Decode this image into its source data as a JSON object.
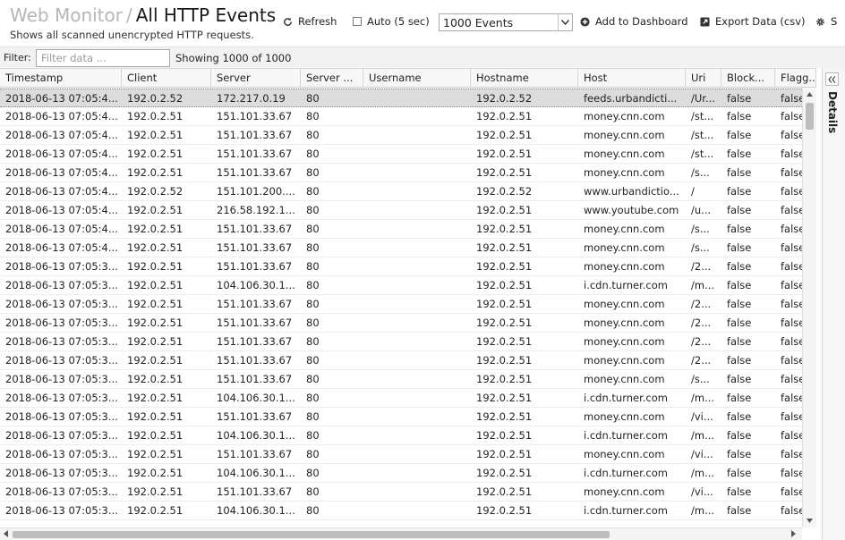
{
  "header": {
    "crumb": "Web Monitor",
    "separator": "/",
    "page_title": "All HTTP Events",
    "subtitle": "Shows all scanned unencrypted HTTP requests."
  },
  "toolbar": {
    "refresh_label": "Refresh",
    "auto_label": "Auto (5 sec)",
    "auto_checked": false,
    "events_select_value": "1000 Events",
    "add_dashboard_label": "Add to Dashboard",
    "export_label": "Export Data (csv)",
    "settings_label": "S"
  },
  "filter": {
    "label": "Filter:",
    "placeholder": "Filter data ...",
    "showing": "Showing 1000 of 1000"
  },
  "details_label": "Details",
  "columns": [
    "Timestamp",
    "Client",
    "Server",
    "Server ...",
    "Username",
    "Hostname",
    "Host",
    "Uri",
    "Block...",
    "Flagg..."
  ],
  "rows": [
    [
      "2018-06-13 07:05:4...",
      "192.0.2.52",
      "172.217.0.19",
      "80",
      "",
      "192.0.2.52",
      "feeds.urbandicti...",
      "/Ur...",
      "false",
      "false"
    ],
    [
      "2018-06-13 07:05:4...",
      "192.0.2.51",
      "151.101.33.67",
      "80",
      "",
      "192.0.2.51",
      "money.cnn.com",
      "/st...",
      "false",
      "false"
    ],
    [
      "2018-06-13 07:05:4...",
      "192.0.2.51",
      "151.101.33.67",
      "80",
      "",
      "192.0.2.51",
      "money.cnn.com",
      "/st...",
      "false",
      "false"
    ],
    [
      "2018-06-13 07:05:4...",
      "192.0.2.51",
      "151.101.33.67",
      "80",
      "",
      "192.0.2.51",
      "money.cnn.com",
      "/st...",
      "false",
      "false"
    ],
    [
      "2018-06-13 07:05:4...",
      "192.0.2.51",
      "151.101.33.67",
      "80",
      "",
      "192.0.2.51",
      "money.cnn.com",
      "/s...",
      "false",
      "false"
    ],
    [
      "2018-06-13 07:05:4...",
      "192.0.2.52",
      "151.101.200....",
      "80",
      "",
      "192.0.2.52",
      "www.urbandictio...",
      "/",
      "false",
      "false"
    ],
    [
      "2018-06-13 07:05:4...",
      "192.0.2.51",
      "216.58.192.1...",
      "80",
      "",
      "192.0.2.51",
      "www.youtube.com",
      "/u...",
      "false",
      "false"
    ],
    [
      "2018-06-13 07:05:4...",
      "192.0.2.51",
      "151.101.33.67",
      "80",
      "",
      "192.0.2.51",
      "money.cnn.com",
      "/s...",
      "false",
      "false"
    ],
    [
      "2018-06-13 07:05:4...",
      "192.0.2.51",
      "151.101.33.67",
      "80",
      "",
      "192.0.2.51",
      "money.cnn.com",
      "/s...",
      "false",
      "false"
    ],
    [
      "2018-06-13 07:05:3...",
      "192.0.2.51",
      "151.101.33.67",
      "80",
      "",
      "192.0.2.51",
      "money.cnn.com",
      "/2...",
      "false",
      "false"
    ],
    [
      "2018-06-13 07:05:3...",
      "192.0.2.51",
      "104.106.30.1...",
      "80",
      "",
      "192.0.2.51",
      "i.cdn.turner.com",
      "/m...",
      "false",
      "false"
    ],
    [
      "2018-06-13 07:05:3...",
      "192.0.2.51",
      "151.101.33.67",
      "80",
      "",
      "192.0.2.51",
      "money.cnn.com",
      "/2...",
      "false",
      "false"
    ],
    [
      "2018-06-13 07:05:3...",
      "192.0.2.51",
      "151.101.33.67",
      "80",
      "",
      "192.0.2.51",
      "money.cnn.com",
      "/2...",
      "false",
      "false"
    ],
    [
      "2018-06-13 07:05:3...",
      "192.0.2.51",
      "151.101.33.67",
      "80",
      "",
      "192.0.2.51",
      "money.cnn.com",
      "/2...",
      "false",
      "false"
    ],
    [
      "2018-06-13 07:05:3...",
      "192.0.2.51",
      "151.101.33.67",
      "80",
      "",
      "192.0.2.51",
      "money.cnn.com",
      "/2...",
      "false",
      "false"
    ],
    [
      "2018-06-13 07:05:3...",
      "192.0.2.51",
      "151.101.33.67",
      "80",
      "",
      "192.0.2.51",
      "money.cnn.com",
      "/s...",
      "false",
      "false"
    ],
    [
      "2018-06-13 07:05:3...",
      "192.0.2.51",
      "104.106.30.1...",
      "80",
      "",
      "192.0.2.51",
      "i.cdn.turner.com",
      "/m...",
      "false",
      "false"
    ],
    [
      "2018-06-13 07:05:3...",
      "192.0.2.51",
      "151.101.33.67",
      "80",
      "",
      "192.0.2.51",
      "money.cnn.com",
      "/vi...",
      "false",
      "false"
    ],
    [
      "2018-06-13 07:05:3...",
      "192.0.2.51",
      "104.106.30.1...",
      "80",
      "",
      "192.0.2.51",
      "i.cdn.turner.com",
      "/m...",
      "false",
      "false"
    ],
    [
      "2018-06-13 07:05:3...",
      "192.0.2.51",
      "151.101.33.67",
      "80",
      "",
      "192.0.2.51",
      "money.cnn.com",
      "/vi...",
      "false",
      "false"
    ],
    [
      "2018-06-13 07:05:3...",
      "192.0.2.51",
      "104.106.30.1...",
      "80",
      "",
      "192.0.2.51",
      "i.cdn.turner.com",
      "/m...",
      "false",
      "false"
    ],
    [
      "2018-06-13 07:05:3...",
      "192.0.2.51",
      "151.101.33.67",
      "80",
      "",
      "192.0.2.51",
      "money.cnn.com",
      "/vi...",
      "false",
      "false"
    ],
    [
      "2018-06-13 07:05:3...",
      "192.0.2.51",
      "104.106.30.1...",
      "80",
      "",
      "192.0.2.51",
      "i.cdn.turner.com",
      "/m...",
      "false",
      "false"
    ]
  ]
}
